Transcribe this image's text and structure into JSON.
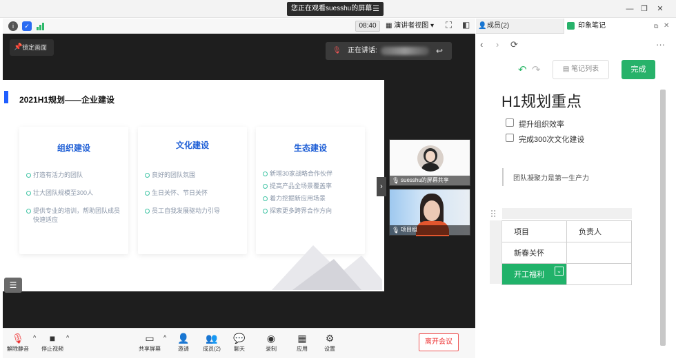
{
  "window": {
    "watch_banner": "您正在观看suesshu的屏幕",
    "minimize": "—",
    "restore": "❐",
    "close": "✕"
  },
  "topbar": {
    "clock": "08:40",
    "view_mode": "演讲者视图"
  },
  "stage": {
    "lock_label": "锁定画面",
    "speaking_label": "正在讲话:",
    "slide": {
      "title": "2021H1规划——企业建设",
      "cards": [
        {
          "title": "组织建设",
          "items": [
            "打造有活力的团队",
            "壮大团队规模至300人",
            "提供专业的培训，帮助团队成员快速适应"
          ]
        },
        {
          "title": "文化建设",
          "items": [
            "良好的团队氛围",
            "生日关怀、节日关怀",
            "员工自我发展驱动力引导"
          ]
        },
        {
          "title": "生态建设",
          "items": [
            "新增30家战略合作伙伴",
            "提高产品全场景覆盖率",
            "着力挖掘新应用场景",
            "探索更多跨界合作方向"
          ]
        }
      ]
    },
    "tiles": [
      {
        "label": "suesshu的屏幕共享"
      },
      {
        "label": "项目组"
      }
    ]
  },
  "bottombar": {
    "mute": "解除静音",
    "video": "停止视频",
    "share": "共享屏幕",
    "invite": "邀请",
    "members": "成员(2)",
    "chat": "聊天",
    "record": "录制",
    "apps": "应用",
    "settings": "设置",
    "leave": "离开会议"
  },
  "right_panel": {
    "tab_members": "成员(2)",
    "tab_notes": "印象笔记",
    "note_list": "笔记列表",
    "done": "完成",
    "heading": "H1规划重点",
    "checklist": [
      "提升组织效率",
      "完成300次文化建设"
    ],
    "quote": "团队凝聚力是第一生产力",
    "table": {
      "headers": [
        "项目",
        "负责人"
      ],
      "rows": [
        [
          "新春关怀",
          ""
        ],
        [
          "开工福利",
          ""
        ]
      ]
    }
  },
  "colors": {
    "accent_green": "#27b26a",
    "slide_blue": "#1f5fd6",
    "leave_red": "#e33333"
  }
}
